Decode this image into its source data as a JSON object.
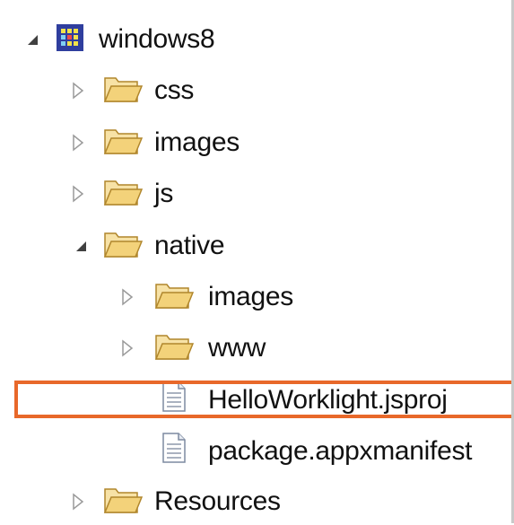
{
  "tree": {
    "root": {
      "label": "windows8",
      "icon": "project-grid-icon",
      "expanded": true
    },
    "items": [
      {
        "label": "css",
        "icon": "folder-icon",
        "expanded": false
      },
      {
        "label": "images",
        "icon": "folder-icon",
        "expanded": false
      },
      {
        "label": "js",
        "icon": "folder-icon",
        "expanded": false
      },
      {
        "label": "native",
        "icon": "folder-icon",
        "expanded": true
      },
      {
        "label": "images",
        "icon": "folder-icon",
        "expanded": false
      },
      {
        "label": "www",
        "icon": "folder-icon",
        "expanded": false
      },
      {
        "label": "HelloWorklight.jsproj",
        "icon": "file-icon",
        "selected": true
      },
      {
        "label": "package.appxmanifest",
        "icon": "file-icon"
      },
      {
        "label": "Resources",
        "icon": "folder-icon",
        "expanded": false
      }
    ]
  },
  "colors": {
    "selection_border": "#e8682a",
    "folder_fill": "#f3d27a",
    "project_icon": "#2f3e9e"
  }
}
